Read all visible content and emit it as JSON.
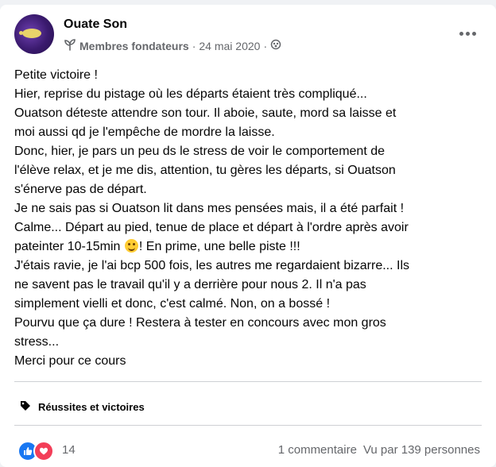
{
  "post": {
    "author": "Ouate Son",
    "group_label": "Membres fondateurs",
    "separator": "·",
    "date": "24 mai 2020",
    "lines": [
      "Petite victoire !",
      "Hier, reprise du pistage où les départs étaient très compliqué...",
      "Ouatson déteste attendre son tour. Il aboie, saute, mord sa laisse et",
      "moi aussi qd je l'empêche de mordre la laisse.",
      "Donc, hier, je pars un peu ds le stress de voir le comportement de",
      "l'élève relax, et je me dis, attention, tu gères les départs, si Ouatson",
      "s'énerve pas de départ.",
      "Je ne sais pas si Ouatson lit dans mes pensées mais, il a été parfait !",
      "Calme... Départ au pied, tenue de place et départ à l'ordre après avoir"
    ],
    "line_emoji_before": "pateinter 10-15min",
    "line_emoji_after": "! En prime, une belle piste !!!",
    "lines_after": [
      "J'étais ravie, je l'ai bcp 500 fois, les autres me regardaient bizarre... Ils",
      "ne savent pas le travail qu'il y a derrière pour nous 2. Il n'a pas",
      "simplement vielli et donc, c'est calmé. Non, on a bossé !",
      "Pourvu que ça dure ! Restera à tester en concours avec mon gros",
      "stress...",
      "Merci pour ce cours"
    ]
  },
  "topic": {
    "label": "Réussites et victoires",
    "icon": "tag-icon"
  },
  "stats": {
    "reaction_count": "14",
    "comments": "1 commentaire",
    "views": "Vu par 139 personnes"
  },
  "colors": {
    "like": "#1877f2",
    "love": "#f33e58",
    "secondary_text": "#65676b"
  }
}
